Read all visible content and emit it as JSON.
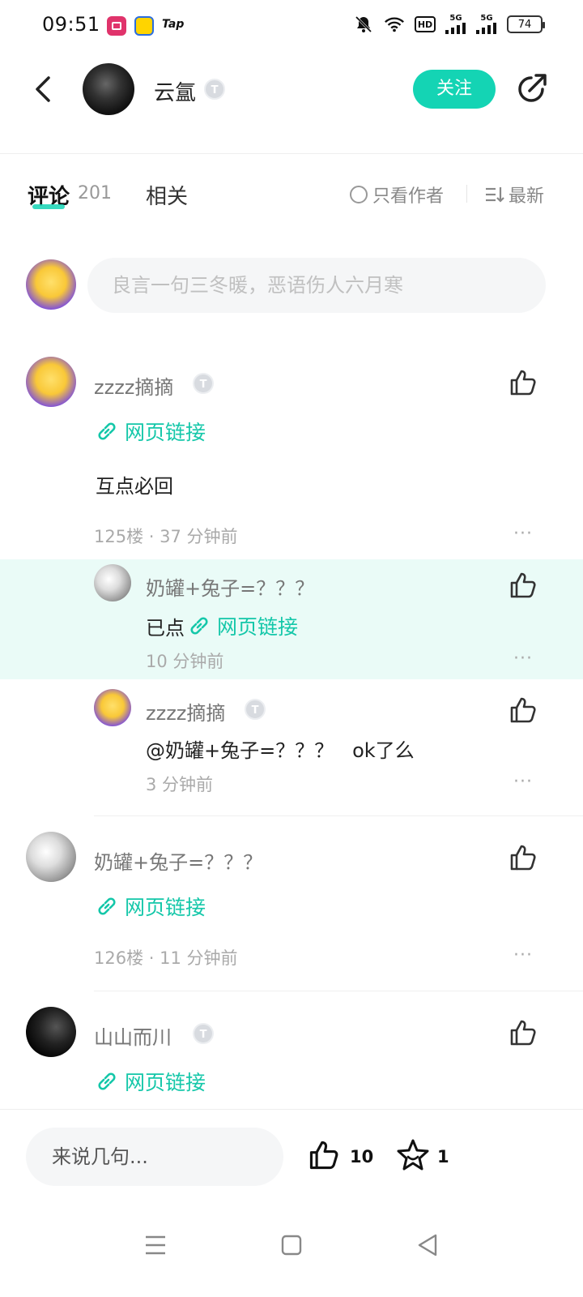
{
  "status_bar": {
    "time": "09:51",
    "tap_label": "Tap",
    "hd_label": "HD",
    "signal1": "5G",
    "signal2": "5G",
    "battery": "74"
  },
  "header": {
    "author_name": "云氲",
    "badge_label": "T",
    "follow_label": "关注"
  },
  "tabs": {
    "comments_label": "评论",
    "comments_count": "201",
    "related_label": "相关",
    "author_only_label": "只看作者",
    "sort_label": "最新"
  },
  "comment_input": {
    "placeholder": "良言一句三冬暖，恶语伤人六月寒"
  },
  "comments": [
    {
      "user": "zzzz摘摘",
      "link_label": "网页链接",
      "text": "互点必回",
      "meta": "125楼 · 37 分钟前",
      "more": "···"
    },
    {
      "user": "奶罐+兔子=？？？",
      "link_label": "网页链接",
      "meta": "126楼 · 11 分钟前",
      "more": "···"
    },
    {
      "user": "山山而川",
      "link_label": "网页链接"
    }
  ],
  "replies": [
    {
      "user": "奶罐+兔子=？？？",
      "text_prefix": "已点",
      "link_label": "网页链接",
      "time": "10 分钟前",
      "more": "···"
    },
    {
      "user": "zzzz摘摘",
      "text": "@奶罐+兔子=？？？   ok了么",
      "time": "3 分钟前",
      "more": "···"
    }
  ],
  "bottom_bar": {
    "input_placeholder": "来说几句...",
    "like_count": "10",
    "star_count": "1"
  },
  "colors": {
    "accent": "#14d4b4",
    "link": "#14c7a9",
    "highlight": "#eafbf7"
  }
}
